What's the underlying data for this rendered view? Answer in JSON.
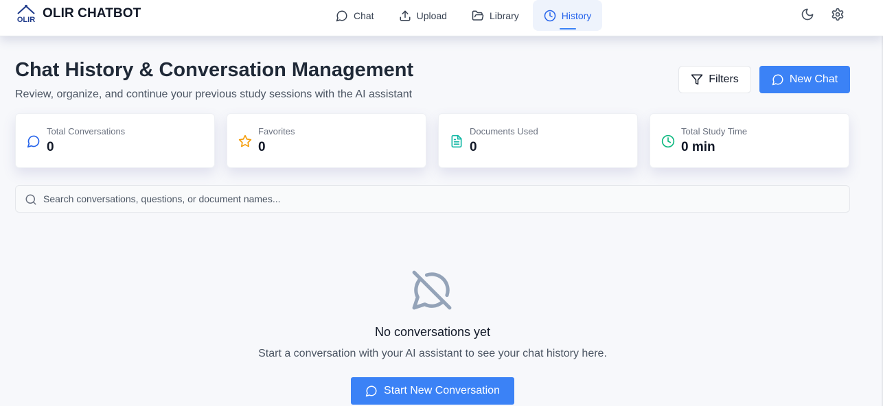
{
  "app": {
    "name": "OLIR CHATBOT",
    "logo_text": "OLIR"
  },
  "nav": {
    "tabs": [
      {
        "label": "Chat",
        "icon": "message-circle-icon",
        "active": false
      },
      {
        "label": "Upload",
        "icon": "upload-icon",
        "active": false
      },
      {
        "label": "Library",
        "icon": "folder-open-icon",
        "active": false
      },
      {
        "label": "History",
        "icon": "clock-icon",
        "active": true
      }
    ]
  },
  "toolbar": {
    "theme_icon": "moon-icon",
    "settings_icon": "gear-icon"
  },
  "header": {
    "title": "Chat History & Conversation Management",
    "subtitle": "Review, organize, and continue your previous study sessions with the AI assistant",
    "filters_label": "Filters",
    "new_chat_label": "New Chat"
  },
  "stats": [
    {
      "label": "Total Conversations",
      "value": "0",
      "icon": "message-circle-icon",
      "color": "#2563eb"
    },
    {
      "label": "Favorites",
      "value": "0",
      "icon": "star-icon",
      "color": "#f59e0b"
    },
    {
      "label": "Documents Used",
      "value": "0",
      "icon": "file-text-icon",
      "color": "#14b8a6"
    },
    {
      "label": "Total Study Time",
      "value": "0 min",
      "icon": "clock-icon",
      "color": "#10b981"
    }
  ],
  "search": {
    "placeholder": "Search conversations, questions, or document names...",
    "value": ""
  },
  "empty_state": {
    "icon": "message-circle-off-icon",
    "title": "No conversations yet",
    "description": "Start a conversation with your AI assistant to see your chat history here.",
    "button_label": "Start New Conversation"
  },
  "colors": {
    "accent": "#3b82f6",
    "active_tab_bg": "#eef3fc",
    "muted_icon": "#94a3b8"
  }
}
